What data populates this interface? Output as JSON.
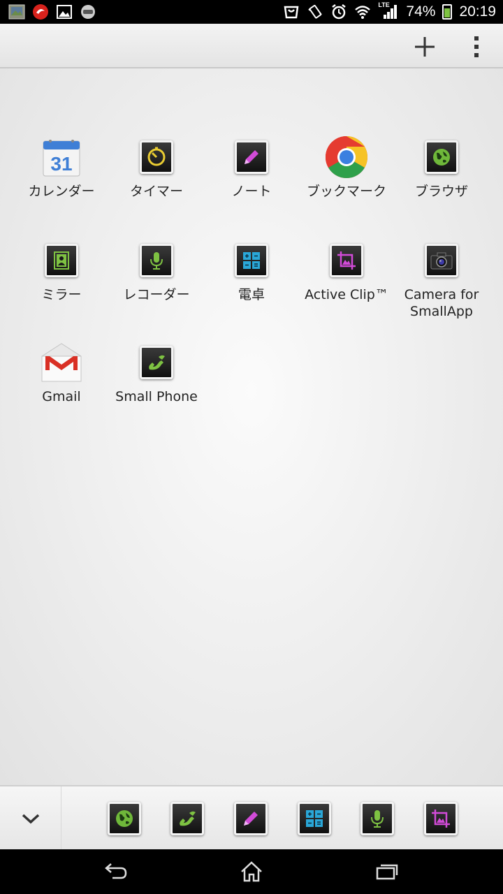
{
  "status_bar": {
    "battery_percent": "74%",
    "battery_level": 0.74,
    "time": "20:19",
    "network_type": "LTE",
    "icons_left": [
      "gallery-thumbnail-icon",
      "red-app-icon",
      "image-icon",
      "podcast-icon"
    ],
    "icons_right": [
      "shopping-bag-icon",
      "vibrate-icon",
      "alarm-icon",
      "wifi-icon",
      "signal-icon",
      "battery-icon"
    ]
  },
  "action_bar": {
    "add_icon": "plus-icon",
    "menu_icon": "overflow-menu-icon"
  },
  "apps": [
    {
      "label": "カレンダー",
      "icon": "calendar-icon",
      "calendar_day": "31"
    },
    {
      "label": "タイマー",
      "icon": "timer-icon"
    },
    {
      "label": "ノート",
      "icon": "note-icon"
    },
    {
      "label": "ブックマーク",
      "icon": "chrome-icon"
    },
    {
      "label": "ブラウザ",
      "icon": "browser-icon"
    },
    {
      "label": "ミラー",
      "icon": "mirror-icon"
    },
    {
      "label": "レコーダー",
      "icon": "recorder-icon"
    },
    {
      "label": "電卓",
      "icon": "calculator-icon"
    },
    {
      "label": "Active Clip™",
      "icon": "active-clip-icon"
    },
    {
      "label": "Camera for SmallApp",
      "icon": "camera-icon"
    },
    {
      "label": "Gmail",
      "icon": "gmail-icon"
    },
    {
      "label": "Small Phone",
      "icon": "phone-icon"
    }
  ],
  "tray": {
    "collapse_icon": "chevron-down-icon",
    "items": [
      "browser-icon",
      "phone-icon",
      "note-icon",
      "calculator-icon",
      "recorder-icon",
      "active-clip-icon"
    ]
  },
  "nav_bar": {
    "buttons": [
      "back-icon",
      "home-icon",
      "recent-apps-icon"
    ]
  },
  "colors": {
    "tile_dark": "#1a1a1a",
    "green": "#7ec242",
    "magenta": "#d24bd8",
    "cyan": "#2aa7d8",
    "gmail_red": "#d93025"
  }
}
